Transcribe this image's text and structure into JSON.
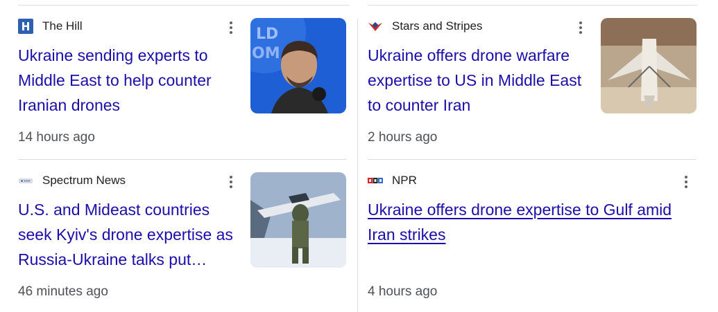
{
  "cards": [
    {
      "source": "The Hill",
      "favicon": "the-hill-logo",
      "headline": "Ukraine sending experts to Middle East to help counter Iranian drones",
      "time": "14 hours ago",
      "thumbnail": "zelensky-speaking-photo",
      "more_icon": "more-vert-icon"
    },
    {
      "source": "Stars and Stripes",
      "favicon": "stars-and-stripes-logo",
      "headline": "Ukraine offers drone warfare expertise to US in Middle East to counter Iran",
      "time": "2 hours ago",
      "thumbnail": "drone-display-photo",
      "more_icon": "more-vert-icon"
    },
    {
      "source": "Spectrum News",
      "favicon": "spectrum-news-logo",
      "headline": "U.S. and Mideast countries seek Kyiv's drone expertise as Russia-Ukraine talks put…",
      "time": "46 minutes ago",
      "thumbnail": "soldier-carrying-drone-photo",
      "more_icon": "more-vert-icon"
    },
    {
      "source": "NPR",
      "favicon": "npr-logo",
      "headline": "Ukraine offers drone expertise to Gulf amid Iran strikes",
      "time": "4 hours ago",
      "more_icon": "more-vert-icon"
    }
  ],
  "colors": {
    "link": "#1a0dab",
    "meta": "#4d5156",
    "divider": "#dadce0"
  }
}
